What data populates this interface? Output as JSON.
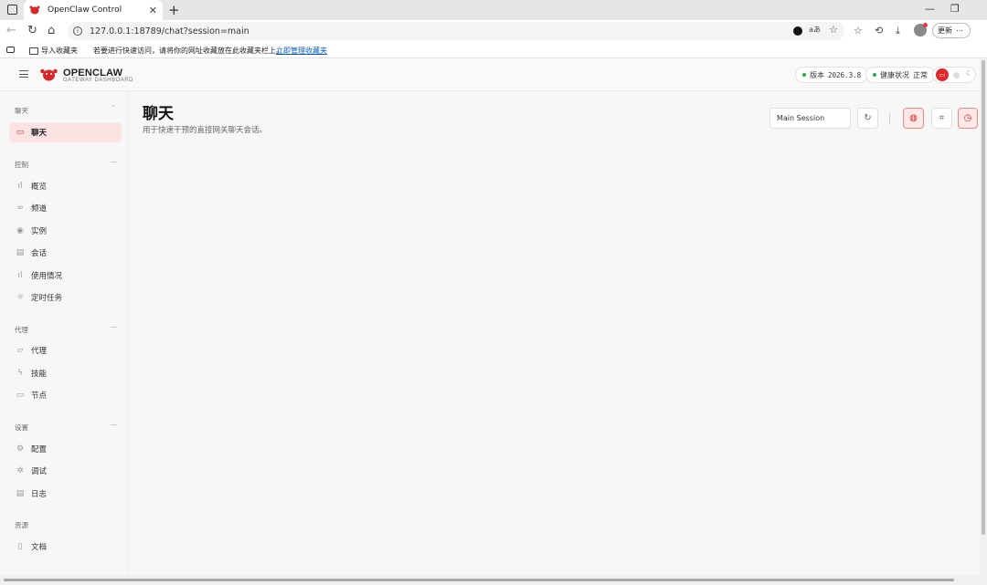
{
  "browser": {
    "tab_title": "OpenClaw Control",
    "url": "127.0.0.1:18789/chat?session=main",
    "update_label": "更新",
    "bookmarks": {
      "import_label": "导入收藏夹",
      "hint": "若要进行快速访问，请将你的网址收藏放在此收藏夹栏上。",
      "manage_link": "立即管理收藏夹"
    }
  },
  "header": {
    "brand_title": "OPENCLAW",
    "brand_subtitle": "GATEWAY DASHBOARD",
    "version_label": "版本",
    "version_value": "2026.3.8",
    "health_label": "健康状况",
    "health_value": "正常",
    "status_color": "#22aa55",
    "accent_color": "#e2272b"
  },
  "sidebar": {
    "sections": [
      {
        "title": "聊天",
        "items": [
          {
            "label": "聊天",
            "icon": "chat-bubble-icon",
            "active": true
          }
        ]
      },
      {
        "title": "控制",
        "items": [
          {
            "label": "概览",
            "icon": "bar-chart-icon"
          },
          {
            "label": "频道",
            "icon": "link-icon"
          },
          {
            "label": "实例",
            "icon": "broadcast-icon"
          },
          {
            "label": "会话",
            "icon": "document-icon"
          },
          {
            "label": "使用情况",
            "icon": "bar-chart-icon"
          },
          {
            "label": "定时任务",
            "icon": "sun-icon"
          }
        ]
      },
      {
        "title": "代理",
        "items": [
          {
            "label": "代理",
            "icon": "folder-icon"
          },
          {
            "label": "技能",
            "icon": "lightning-icon"
          },
          {
            "label": "节点",
            "icon": "monitor-icon"
          }
        ]
      },
      {
        "title": "设置",
        "items": [
          {
            "label": "配置",
            "icon": "gear-icon"
          },
          {
            "label": "调试",
            "icon": "bug-icon"
          },
          {
            "label": "日志",
            "icon": "log-icon"
          }
        ]
      },
      {
        "title": "资源",
        "items": [
          {
            "label": "文档",
            "icon": "book-icon"
          }
        ]
      }
    ]
  },
  "main": {
    "title": "聊天",
    "subtitle": "用于快速干预的直接网关聊天会话。",
    "session_select": "Main Session"
  }
}
